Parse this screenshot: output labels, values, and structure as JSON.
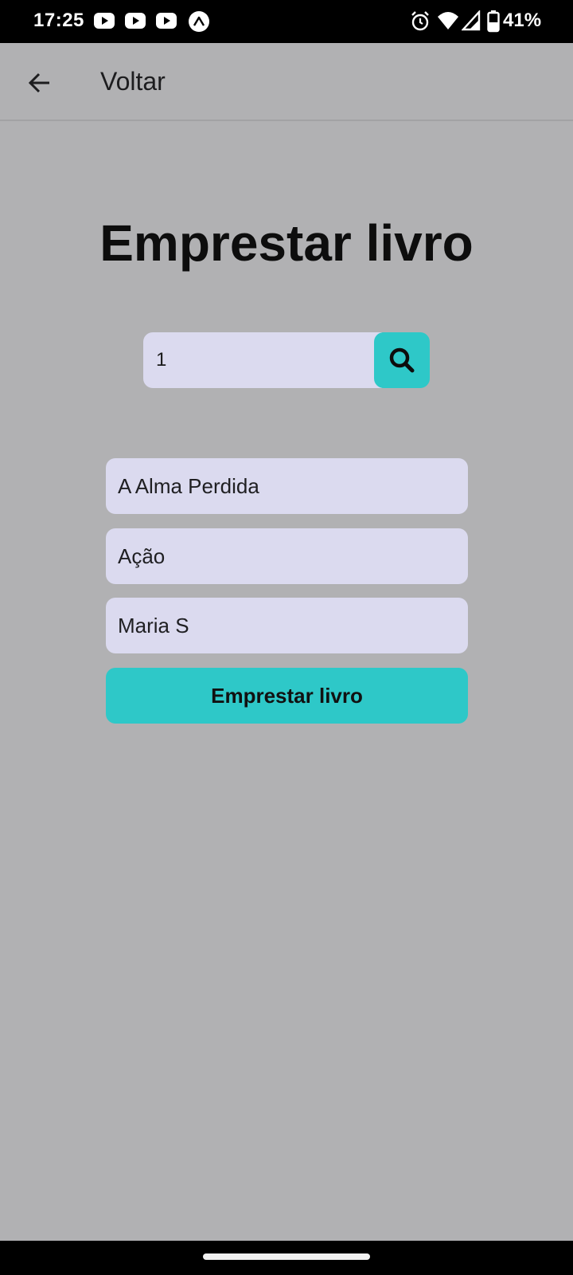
{
  "status_bar": {
    "time": "17:25",
    "battery_percent": "41%",
    "icons": [
      "youtube-icon",
      "youtube-icon",
      "youtube-icon",
      "expo-icon",
      "alarm-icon",
      "wifi-icon",
      "signal-icon",
      "battery-icon"
    ]
  },
  "app_bar": {
    "back_icon": "arrow-left-icon",
    "title": "Voltar"
  },
  "main": {
    "title": "Emprestar livro",
    "search": {
      "value": "1",
      "icon": "search-icon"
    },
    "fields": {
      "book_title": "A Alma Perdida",
      "genre": "Ação",
      "person": "Maria S"
    },
    "submit_label": "Emprestar livro"
  },
  "colors": {
    "background": "#b1b1b3",
    "input_bg": "#dbdaef",
    "accent": "#2ec8c8"
  }
}
